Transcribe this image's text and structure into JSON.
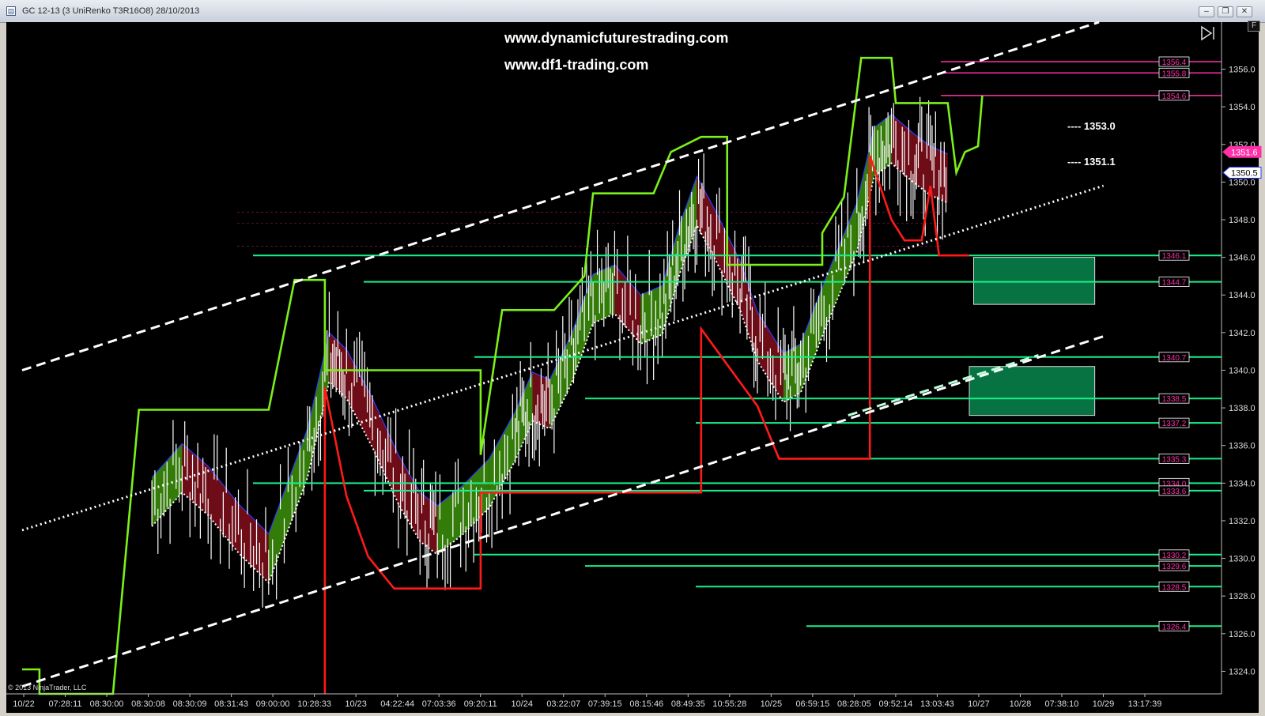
{
  "window": {
    "title": "GC 12-13 (3 UniRenko T3R16O8)  28/10/2013",
    "minimize_glyph": "–",
    "restore_glyph": "❐",
    "close_glyph": "✕",
    "f_button_label": "F",
    "icon": "chart-window-icon"
  },
  "watermarks": [
    "www.dynamicfuturestrading.com",
    "www.df1-trading.com"
  ],
  "copyright": "© 2013 NinjaTrader, LLC",
  "icons": {
    "go_to_end": "skip-to-end-icon"
  },
  "colors": {
    "background": "#000000",
    "price_bars": "#ffffff",
    "upper_step": "#7cf019",
    "lower_step": "#ff1a1a",
    "bull_band": "#3a8a0a",
    "bear_band": "#7a0e1a",
    "support_lines": "#18f08a",
    "resistance_lines": "#ff2fa8",
    "zone_fill": "#0a9a5a",
    "channel": "#ffffff"
  },
  "chart_data": {
    "type": "line",
    "instrument": "GC 12-13 (3 UniRenko T3R16O8)",
    "date": "28/10/2013",
    "ylim": [
      1322.8,
      1358.5
    ],
    "y_ticks": [
      1356.0,
      1354.0,
      1352.0,
      1350.0,
      1348.0,
      1346.0,
      1344.0,
      1342.0,
      1340.0,
      1338.0,
      1336.0,
      1334.0,
      1332.0,
      1330.0,
      1328.0,
      1326.0,
      1324.0
    ],
    "x_labels": [
      "10/22",
      "07:28:11",
      "08:30:00",
      "08:30:08",
      "08:30:09",
      "08:31:43",
      "09:00:00",
      "10:28:33",
      "10/23",
      "04:22:44",
      "07:03:36",
      "09:20:11",
      "10/24",
      "03:22:07",
      "07:39:15",
      "08:15:46",
      "08:49:35",
      "10:55:28",
      "10/25",
      "06:59:15",
      "08:28:05",
      "09:52:14",
      "13:03:43",
      "10/27",
      "10/28",
      "07:38:10",
      "10/29",
      "13:17:39"
    ],
    "price_labels": [
      {
        "value": 1351.6,
        "kind": "last"
      },
      {
        "value": 1350.5,
        "kind": "current"
      }
    ],
    "resistance_levels": [
      1356.4,
      1355.8,
      1354.6
    ],
    "support_levels": [
      1346.1,
      1344.7,
      1340.7,
      1338.5,
      1337.2,
      1335.3,
      1334.0,
      1333.6,
      1330.2,
      1329.6,
      1328.5,
      1326.4
    ],
    "annotations": [
      {
        "text": "1353.0",
        "value": 1353.0
      },
      {
        "text": "1351.1",
        "value": 1351.1
      }
    ],
    "zones": [
      {
        "x_start": 22.0,
        "x_end": 24.8,
        "y_low": 1343.5,
        "y_high": 1346.0
      },
      {
        "x_start": 21.9,
        "x_end": 24.8,
        "y_low": 1337.6,
        "y_high": 1340.2
      }
    ],
    "channel": {
      "upper": [
        [
          0.0,
          1340.0
        ],
        [
          24.9,
          1358.5
        ]
      ],
      "middle": [
        [
          0.0,
          1331.5
        ],
        [
          25.0,
          1349.8
        ]
      ],
      "lower": [
        [
          0.0,
          1323.2
        ],
        [
          25.0,
          1341.8
        ]
      ],
      "lower_mid": [
        [
          19.1,
          1337.6
        ],
        [
          23.5,
          1340.8
        ]
      ]
    },
    "upper_step": [
      [
        0.0,
        1324.1
      ],
      [
        0.4,
        1324.1
      ],
      [
        0.4,
        1322.8
      ],
      [
        2.1,
        1322.8
      ],
      [
        2.7,
        1337.9
      ],
      [
        5.7,
        1337.9
      ],
      [
        6.3,
        1344.8
      ],
      [
        7.0,
        1344.8
      ],
      [
        7.0,
        1340.0
      ],
      [
        10.6,
        1340.0
      ],
      [
        10.6,
        1335.5
      ],
      [
        11.1,
        1343.2
      ],
      [
        12.3,
        1343.2
      ],
      [
        13.0,
        1345.0
      ],
      [
        13.2,
        1349.4
      ],
      [
        14.6,
        1349.4
      ],
      [
        15.0,
        1351.6
      ],
      [
        15.7,
        1352.4
      ],
      [
        16.3,
        1352.4
      ],
      [
        16.3,
        1345.6
      ],
      [
        18.5,
        1345.6
      ],
      [
        18.5,
        1347.3
      ],
      [
        19.0,
        1349.2
      ],
      [
        19.4,
        1356.6
      ],
      [
        20.1,
        1356.6
      ],
      [
        20.2,
        1354.2
      ],
      [
        21.4,
        1354.2
      ],
      [
        21.6,
        1350.5
      ],
      [
        21.8,
        1351.6
      ],
      [
        22.1,
        1351.9
      ],
      [
        22.2,
        1354.6
      ]
    ],
    "lower_step": [
      [
        7.0,
        1322.8
      ],
      [
        7.0,
        1339.1
      ],
      [
        7.5,
        1333.3
      ],
      [
        8.0,
        1330.1
      ],
      [
        8.6,
        1328.4
      ],
      [
        10.6,
        1328.4
      ],
      [
        10.6,
        1333.5
      ],
      [
        15.7,
        1333.5
      ],
      [
        15.7,
        1342.2
      ],
      [
        16.3,
        1340.3
      ],
      [
        17.0,
        1338.1
      ],
      [
        17.5,
        1335.3
      ],
      [
        19.6,
        1335.3
      ],
      [
        19.6,
        1351.4
      ],
      [
        20.1,
        1348.0
      ],
      [
        20.4,
        1346.9
      ],
      [
        20.8,
        1346.9
      ],
      [
        21.0,
        1349.8
      ],
      [
        21.2,
        1346.1
      ],
      [
        21.9,
        1346.1
      ]
    ],
    "band_mid_points": [
      [
        3.0,
        1333.0
      ],
      [
        3.7,
        1334.8
      ],
      [
        4.3,
        1333.6
      ],
      [
        5.0,
        1331.6
      ],
      [
        5.7,
        1330.0
      ],
      [
        6.6,
        1335.6
      ],
      [
        7.1,
        1340.7
      ],
      [
        7.5,
        1339.8
      ],
      [
        8.1,
        1337.2
      ],
      [
        8.7,
        1334.2
      ],
      [
        9.2,
        1332.2
      ],
      [
        9.6,
        1331.5
      ],
      [
        10.2,
        1332.6
      ],
      [
        10.8,
        1334.0
      ],
      [
        11.4,
        1336.5
      ],
      [
        11.8,
        1338.6
      ],
      [
        12.2,
        1338.2
      ],
      [
        12.7,
        1340.6
      ],
      [
        13.2,
        1343.8
      ],
      [
        13.7,
        1344.3
      ],
      [
        14.3,
        1342.7
      ],
      [
        14.8,
        1343.2
      ],
      [
        15.2,
        1346.4
      ],
      [
        15.6,
        1349.0
      ],
      [
        16.0,
        1347.3
      ],
      [
        16.6,
        1344.5
      ],
      [
        17.0,
        1341.8
      ],
      [
        17.6,
        1339.6
      ],
      [
        18.0,
        1340.1
      ],
      [
        18.6,
        1343.7
      ],
      [
        19.3,
        1347.6
      ],
      [
        19.7,
        1351.6
      ],
      [
        20.1,
        1352.3
      ],
      [
        20.6,
        1351.3
      ],
      [
        21.0,
        1350.6
      ],
      [
        21.4,
        1350.2
      ]
    ]
  }
}
